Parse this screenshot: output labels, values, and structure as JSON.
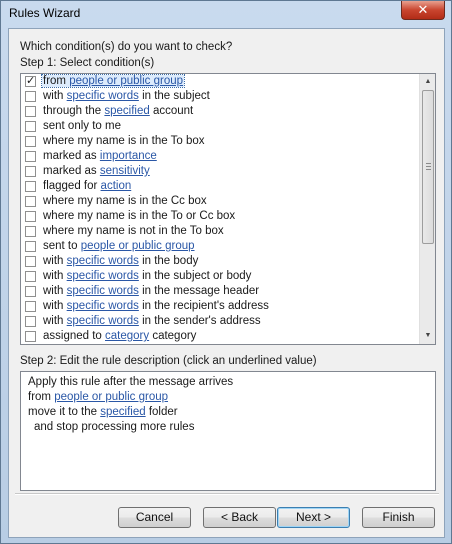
{
  "window": {
    "title": "Rules Wizard",
    "close_label": "✕"
  },
  "question": "Which condition(s) do you want to check?",
  "step1": "Step 1: Select condition(s)",
  "conditions": [
    {
      "checked": true,
      "parts": [
        {
          "t": "from "
        },
        {
          "t": "people or public group",
          "link": true
        }
      ]
    },
    {
      "checked": false,
      "parts": [
        {
          "t": "with "
        },
        {
          "t": "specific words",
          "link": true
        },
        {
          "t": " in the subject"
        }
      ]
    },
    {
      "checked": false,
      "parts": [
        {
          "t": "through the "
        },
        {
          "t": "specified",
          "link": true
        },
        {
          "t": " account"
        }
      ]
    },
    {
      "checked": false,
      "parts": [
        {
          "t": "sent only to me"
        }
      ]
    },
    {
      "checked": false,
      "parts": [
        {
          "t": "where my name is in the To box"
        }
      ]
    },
    {
      "checked": false,
      "parts": [
        {
          "t": "marked as "
        },
        {
          "t": "importance",
          "link": true
        }
      ]
    },
    {
      "checked": false,
      "parts": [
        {
          "t": "marked as "
        },
        {
          "t": "sensitivity",
          "link": true
        }
      ]
    },
    {
      "checked": false,
      "parts": [
        {
          "t": "flagged for "
        },
        {
          "t": "action",
          "link": true
        }
      ]
    },
    {
      "checked": false,
      "parts": [
        {
          "t": "where my name is in the Cc box"
        }
      ]
    },
    {
      "checked": false,
      "parts": [
        {
          "t": "where my name is in the To or Cc box"
        }
      ]
    },
    {
      "checked": false,
      "parts": [
        {
          "t": "where my name is not in the To box"
        }
      ]
    },
    {
      "checked": false,
      "parts": [
        {
          "t": "sent to "
        },
        {
          "t": "people or public group",
          "link": true
        }
      ]
    },
    {
      "checked": false,
      "parts": [
        {
          "t": "with "
        },
        {
          "t": "specific words",
          "link": true
        },
        {
          "t": " in the body"
        }
      ]
    },
    {
      "checked": false,
      "parts": [
        {
          "t": "with "
        },
        {
          "t": "specific words",
          "link": true
        },
        {
          "t": " in the subject or body"
        }
      ]
    },
    {
      "checked": false,
      "parts": [
        {
          "t": "with "
        },
        {
          "t": "specific words",
          "link": true
        },
        {
          "t": " in the message header"
        }
      ]
    },
    {
      "checked": false,
      "parts": [
        {
          "t": "with "
        },
        {
          "t": "specific words",
          "link": true
        },
        {
          "t": " in the recipient's address"
        }
      ]
    },
    {
      "checked": false,
      "parts": [
        {
          "t": "with "
        },
        {
          "t": "specific words",
          "link": true
        },
        {
          "t": " in the sender's address"
        }
      ]
    },
    {
      "checked": false,
      "parts": [
        {
          "t": "assigned to "
        },
        {
          "t": "category",
          "link": true
        },
        {
          "t": " category"
        }
      ]
    }
  ],
  "selected_index": 0,
  "scrollbar": {
    "up_icon": "▲",
    "down_icon": "▼",
    "position": 0.0
  },
  "step2": "Step 2: Edit the rule description (click an underlined value)",
  "description": [
    {
      "indent": false,
      "parts": [
        {
          "t": "Apply this rule after the message arrives"
        }
      ]
    },
    {
      "indent": false,
      "parts": [
        {
          "t": "from "
        },
        {
          "t": "people or public group",
          "link": true
        }
      ]
    },
    {
      "indent": false,
      "parts": [
        {
          "t": "move it to the "
        },
        {
          "t": "specified",
          "link": true
        },
        {
          "t": " folder"
        }
      ]
    },
    {
      "indent": true,
      "parts": [
        {
          "t": "and stop processing more rules"
        }
      ]
    }
  ],
  "buttons": {
    "cancel": "Cancel",
    "back": "< Back",
    "next": "Next >",
    "finish": "Finish"
  },
  "colors": {
    "link": "#2a57a6",
    "selection": "#dcebfc"
  }
}
